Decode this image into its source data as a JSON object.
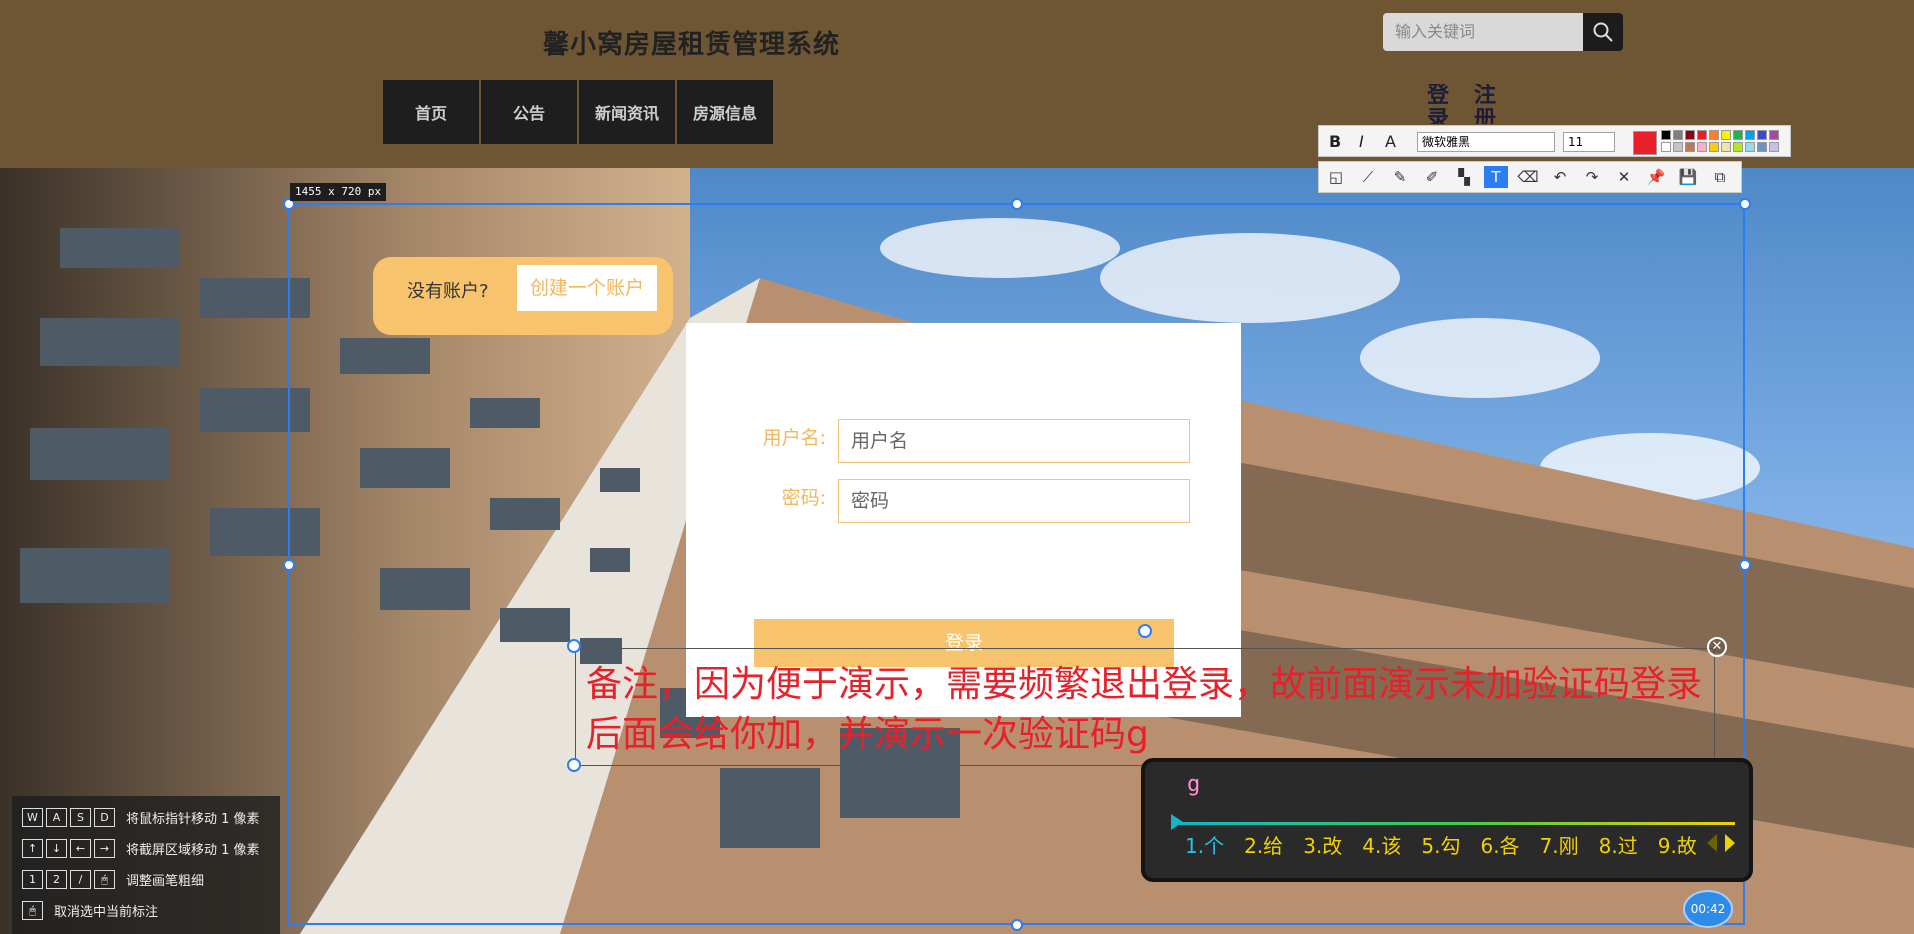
{
  "header": {
    "site_title": "馨小窝房屋租赁管理系统",
    "search_placeholder": "输入关键词",
    "nav": [
      "首页",
      "公告",
      "新闻资讯",
      "房源信息"
    ],
    "login": "登录",
    "register": "注册"
  },
  "screenshot_tool": {
    "size_label": "1455 x 720  px",
    "font": "微软雅黑",
    "font_size": "11",
    "current_color": "#e8202a",
    "palette": [
      "#000000",
      "#7f7f7f",
      "#880015",
      "#ed1c24",
      "#ff7f27",
      "#fff200",
      "#22b14c",
      "#00a2e8",
      "#3f48cc",
      "#a349a4",
      "#ffffff",
      "#c3c3c3",
      "#b97a57",
      "#ffaec9",
      "#ffc90e",
      "#efe4b0",
      "#b5e61d",
      "#99d9ea",
      "#7092be",
      "#c8bfe7"
    ],
    "toolbar1": [
      "B",
      "I",
      "A"
    ],
    "tools": [
      {
        "name": "shape-tool",
        "glyph": "◱"
      },
      {
        "name": "line-tool",
        "glyph": "⟋"
      },
      {
        "name": "pen-tool",
        "glyph": "✎"
      },
      {
        "name": "highlighter-tool",
        "glyph": "✐"
      },
      {
        "name": "mosaic-tool",
        "glyph": "▚"
      },
      {
        "name": "text-tool",
        "glyph": "T"
      },
      {
        "name": "eraser-tool",
        "glyph": "⌫"
      },
      {
        "name": "undo-tool",
        "glyph": "↶"
      },
      {
        "name": "redo-tool",
        "glyph": "↷"
      },
      {
        "name": "close-tool",
        "glyph": "✕"
      },
      {
        "name": "pin-tool",
        "glyph": "📌"
      },
      {
        "name": "save-tool",
        "glyph": "💾"
      },
      {
        "name": "copy-tool",
        "glyph": "⧉"
      }
    ],
    "timer": "00:42"
  },
  "page": {
    "no_account_label": "没有账户?",
    "create_account": "创建一个账户",
    "username_label": "用户名:",
    "username_placeholder": "用户名",
    "password_label": "密码:",
    "password_placeholder": "密码",
    "login_button": "登录"
  },
  "annotation": {
    "line1": "备注，因为便于演示，需要频繁退出登录，故前面演示未加验证码登录",
    "line2": "后面会给你加，并演示一次验证码g"
  },
  "ime": {
    "typed": "g",
    "candidates": [
      "1.个",
      "2.给",
      "3.改",
      "4.该",
      "5.勾",
      "6.各",
      "7.刚",
      "8.过",
      "9.故"
    ]
  },
  "shortcuts": [
    {
      "keys": [
        "W",
        "A",
        "S",
        "D"
      ],
      "text": "将鼠标指针移动 1 像素"
    },
    {
      "keys": [
        "↑",
        "↓",
        "←",
        "→"
      ],
      "text": "将截屏区域移动 1 像素"
    },
    {
      "keys": [
        "1",
        "2",
        "/",
        "🖱"
      ],
      "text": "调整画笔粗细"
    },
    {
      "keys": [
        "🖱"
      ],
      "text": "取消选中当前标注"
    }
  ]
}
